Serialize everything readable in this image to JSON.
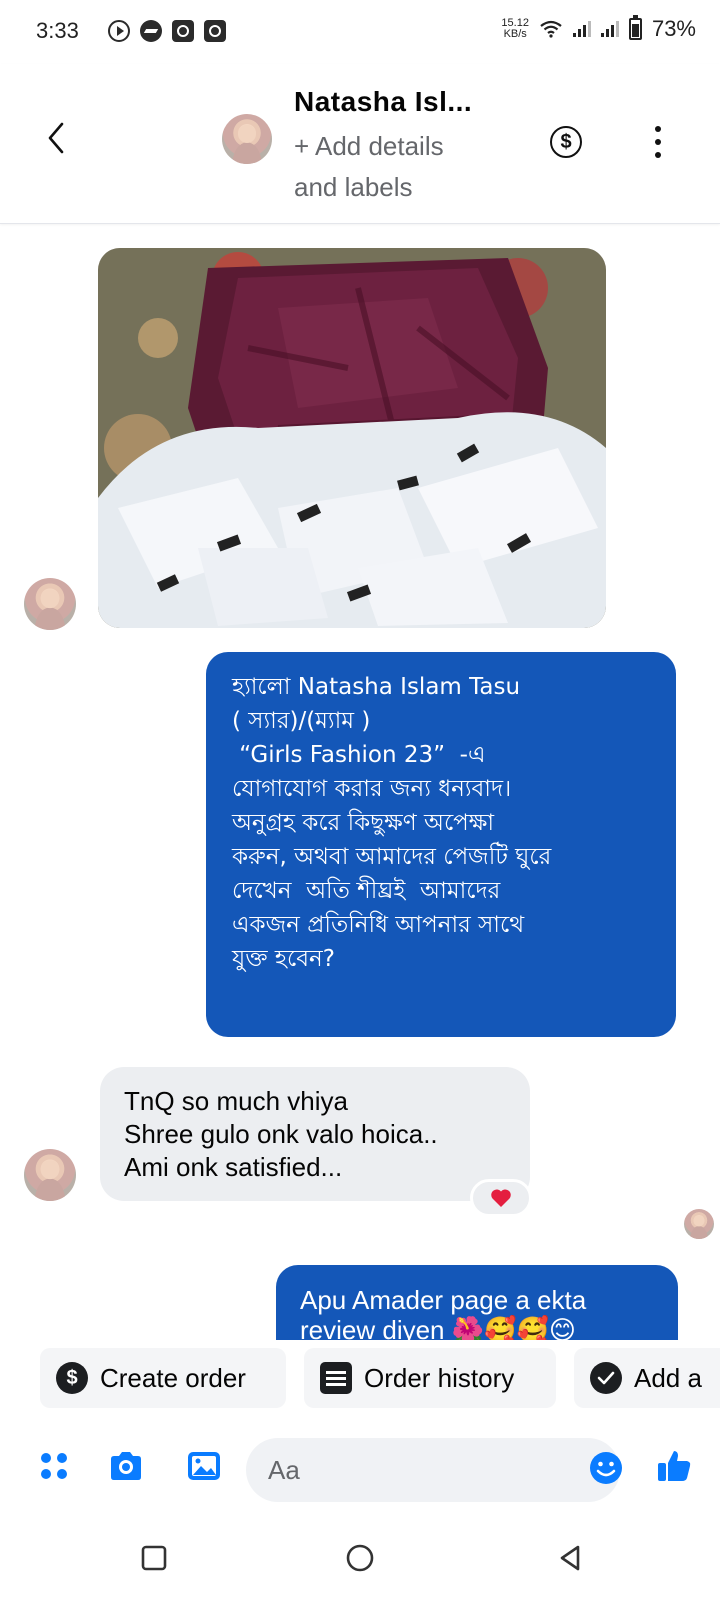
{
  "status_bar": {
    "time": "3:33",
    "net_speed_value": "15.12",
    "net_speed_unit": "KB/s",
    "battery": "73%"
  },
  "header": {
    "contact_name": "Natasha Isl...",
    "add_details": "+ Add details and labels",
    "dollar_icon": "$",
    "icons": [
      "back-arrow-icon",
      "dollar-circle-icon",
      "more-vertical-icon"
    ]
  },
  "messages": {
    "outgoing_auto_reply": {
      "lines": [
        "হ্যালো Natasha Islam Tasu",
        "( স্যার)/(ম্যাম )",
        " “Girls Fashion 23”  -এ",
        "যোগাযোগ করার জন্য ধন্যবাদ।",
        "অনুগ্রহ করে কিছুক্ষণ অপেক্ষা",
        "করুন, অথবা আমাদের পেজটি ঘুরে",
        "দেখেন  অতি শীঘ্রই  আমাদের",
        "একজন প্রতিনিধি আপনার সাথে",
        "যুক্ত হবেন?"
      ]
    },
    "incoming_reply": {
      "lines": [
        "TnQ so much vhiya",
        "Shree gulo onk valo hoica..",
        "Ami onk satisfied..."
      ],
      "reaction": "heart-icon"
    },
    "outgoing_review": {
      "lines": [
        "Apu Amader page a ekta",
        "review diyen 🌺🥰🥰😊"
      ]
    }
  },
  "quick_actions": {
    "create_order": "Create order",
    "order_history": "Order history",
    "add": "Add a",
    "dollar_icon": "$"
  },
  "composer": {
    "placeholder": "Aa",
    "icons": [
      "menu-dots-icon",
      "camera-icon",
      "gallery-icon",
      "emoji-icon",
      "thumbs-up-icon"
    ]
  },
  "colors": {
    "accent": "#1457b8",
    "incoming_bubble": "#eceef1",
    "icon_blue": "#0a7cff",
    "heart": "#e41e3f"
  }
}
